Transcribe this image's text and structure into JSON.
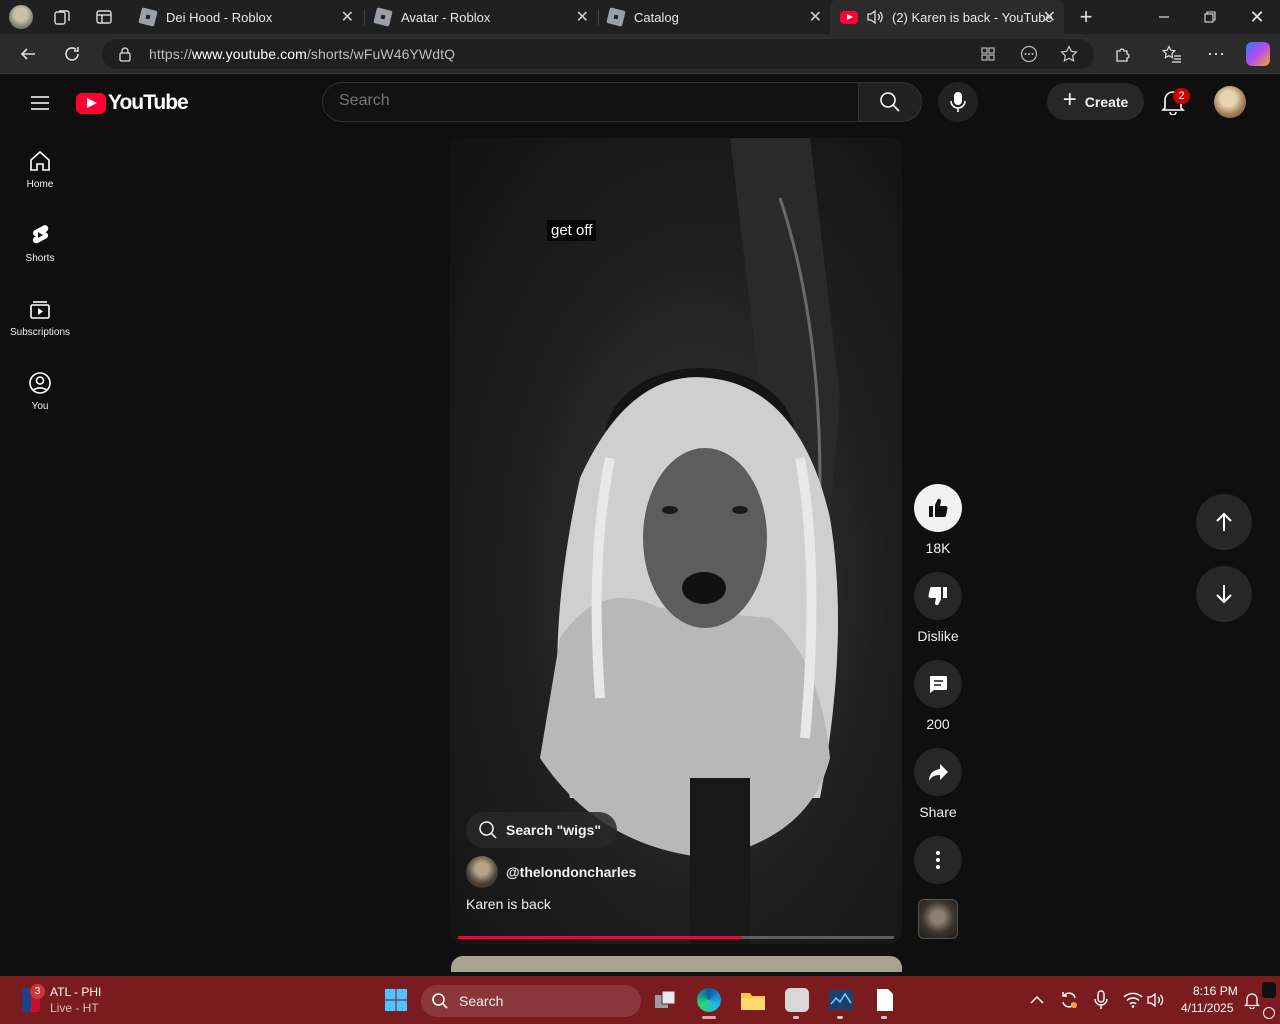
{
  "browser": {
    "tabs": [
      {
        "title": "Dei Hood - Roblox",
        "icon": "roblox-icon"
      },
      {
        "title": "Avatar - Roblox",
        "icon": "roblox-icon"
      },
      {
        "title": "Catalog",
        "icon": "roblox-icon"
      },
      {
        "title": "(2) Karen is back - YouTube",
        "icon": "youtube-icon",
        "active": true,
        "audio": true
      }
    ],
    "url_prefix": "https://",
    "url_host": "www.youtube.com",
    "url_path": "/shorts/wFuW46YWdtQ"
  },
  "youtube": {
    "logo_text": "YouTube",
    "search_placeholder": "Search",
    "create_label": "Create",
    "notification_count": "2",
    "sidebar": [
      {
        "label": "Home",
        "icon": "home-icon"
      },
      {
        "label": "Shorts",
        "icon": "shorts-icon"
      },
      {
        "label": "Subscriptions",
        "icon": "subscriptions-icon"
      },
      {
        "label": "You",
        "icon": "you-icon"
      }
    ],
    "short": {
      "caption": "get off",
      "search_chip": "Search \"wigs\"",
      "channel": "@thelondoncharles",
      "title": "Karen is back",
      "progress": 0.65
    },
    "actions": {
      "likes": "18K",
      "dislike_label": "Dislike",
      "comments": "200",
      "share_label": "Share"
    }
  },
  "taskbar": {
    "game_title": "ATL - PHI",
    "game_status": "Live - HT",
    "game_badge": "3",
    "search_label": "Search",
    "time": "8:16 PM",
    "date": "4/11/2025"
  },
  "colors": {
    "accent_red": "#ff0033",
    "taskbar": "#7a1b1f",
    "page_bg": "#0f0f0f"
  }
}
